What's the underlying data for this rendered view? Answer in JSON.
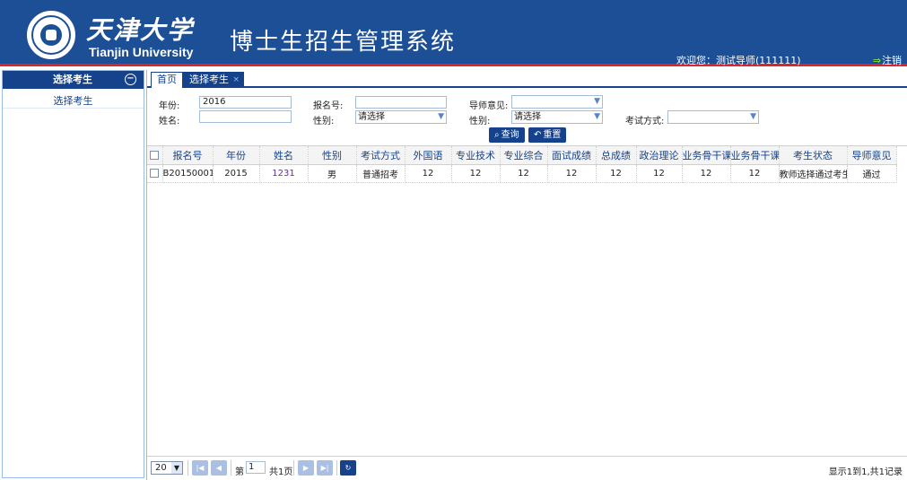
{
  "header": {
    "university_cn": "天津大学",
    "university_en": "Tianjin University",
    "system_title": "博士生招生管理系统",
    "welcome": "欢迎您：测试导师(111111)",
    "logout": "注销"
  },
  "sidebar": {
    "title": "选择考生",
    "items": [
      {
        "label": "选择考生"
      }
    ]
  },
  "tabs": [
    {
      "label": "首页"
    },
    {
      "label": "选择考生"
    }
  ],
  "search": {
    "year_label": "年份:",
    "year_value": "2016",
    "regno_label": "报名号:",
    "regno_value": "",
    "advisor_opinion_label": "导师意见:",
    "advisor_opinion_value": "",
    "name_label": "姓名:",
    "name_value": "",
    "gender_label": "性别:",
    "gender_value": "请选择",
    "gender2_label": "性别:",
    "gender2_value": "请选择",
    "exam_method_label": "考试方式:",
    "exam_method_value": "",
    "query_button": "查询",
    "reset_button": "重置"
  },
  "table": {
    "columns": [
      "报名号",
      "年份",
      "姓名",
      "性别",
      "考试方式",
      "外国语",
      "专业技术",
      "专业综合",
      "面试成绩",
      "总成绩",
      "政治理论",
      "业务骨干课",
      "业务骨干课",
      "考生状态",
      "导师意见"
    ],
    "rows": [
      [
        "B20150001",
        "2015",
        "1231",
        "男",
        "普通招考",
        "12",
        "12",
        "12",
        "12",
        "12",
        "12",
        "12",
        "12",
        "教师选择通过考生",
        "通过"
      ]
    ]
  },
  "pager": {
    "page_size": "20",
    "page_prefix": "第",
    "page_value": "1",
    "page_total": "共1页",
    "display_info": "显示1到1,共1记录"
  },
  "colors": {
    "header_bg": "#1d4f96",
    "header_border": "#d9262c",
    "accent": "#15428b"
  }
}
